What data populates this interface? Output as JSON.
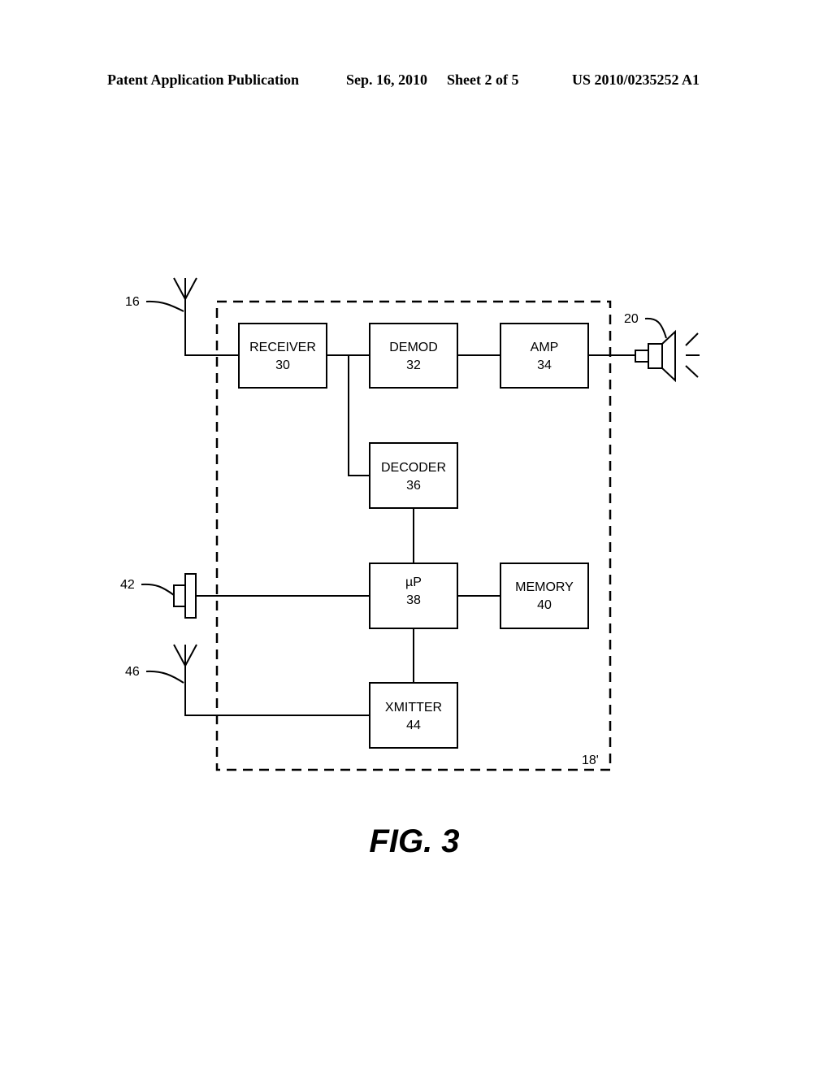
{
  "header": {
    "publication": "Patent Application Publication",
    "date": "Sep. 16, 2010",
    "sheet": "Sheet 2 of 5",
    "number": "US 2010/0235252 A1"
  },
  "figure": {
    "caption": "FIG. 3",
    "device_ref": "18'",
    "blocks": {
      "receiver": {
        "name": "RECEIVER",
        "ref": "30"
      },
      "demod": {
        "name": "DEMOD",
        "ref": "32"
      },
      "amp": {
        "name": "AMP",
        "ref": "34"
      },
      "decoder": {
        "name": "DECODER",
        "ref": "36"
      },
      "up": {
        "name": "µP",
        "ref": "38"
      },
      "memory": {
        "name": "MEMORY",
        "ref": "40"
      },
      "xmitter": {
        "name": "XMITTER",
        "ref": "44"
      }
    },
    "external_refs": {
      "antenna_rx": "16",
      "speaker": "20",
      "button": "42",
      "antenna_tx": "46"
    }
  }
}
